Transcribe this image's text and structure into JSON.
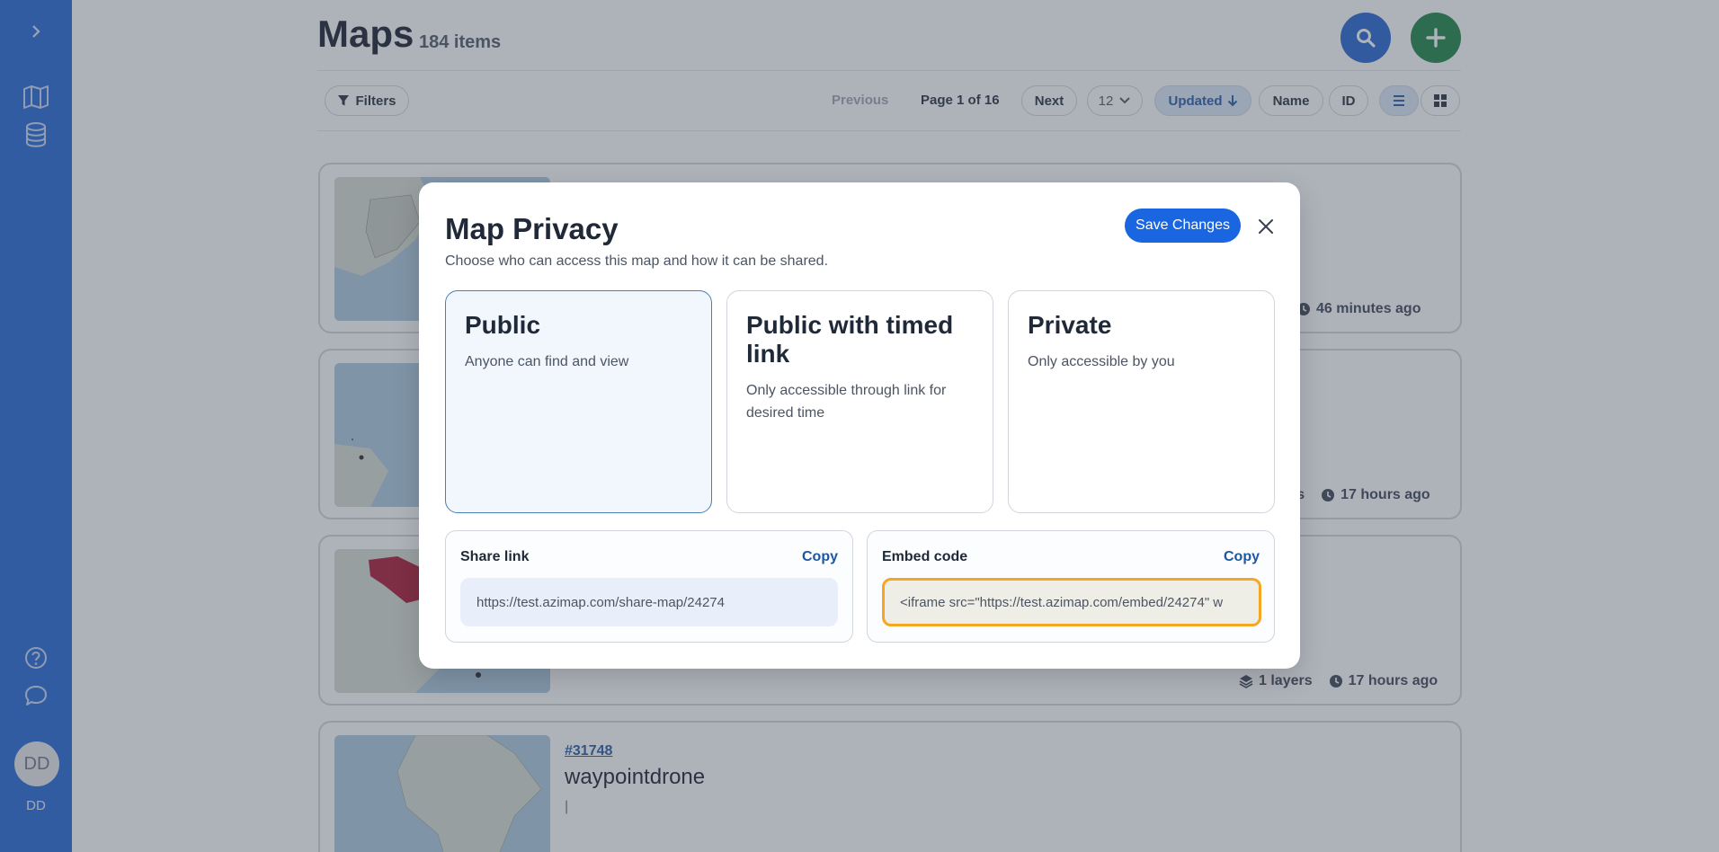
{
  "sidebar": {
    "user_initials": "DD",
    "user_label": "DD"
  },
  "header": {
    "title": "Maps",
    "count": "184 items"
  },
  "toolbar": {
    "filters_label": "Filters",
    "previous_label": "Previous",
    "page_label": "Page 1 of 16",
    "next_label": "Next",
    "per_page": "12",
    "sort_updated": "Updated",
    "sort_name": "Name",
    "sort_id": "ID"
  },
  "cards": [
    {
      "time": "46 minutes ago"
    },
    {
      "layers": "rs",
      "time": "17 hours ago"
    },
    {
      "layers": "1 layers",
      "time": "17 hours ago"
    },
    {
      "id": "#31748",
      "name": "waypointdrone",
      "desc": "|"
    }
  ],
  "modal": {
    "title": "Map Privacy",
    "subtitle": "Choose who can access this map and how it can be shared.",
    "save_label": "Save Changes",
    "options": [
      {
        "title": "Public",
        "desc": "Anyone can find and view",
        "selected": true
      },
      {
        "title": "Public with timed link",
        "desc": "Only accessible through link for desired time",
        "selected": false
      },
      {
        "title": "Private",
        "desc": "Only accessible by you",
        "selected": false
      }
    ],
    "share": {
      "label": "Share link",
      "copy_label": "Copy",
      "value": "https://test.azimap.com/share-map/24274"
    },
    "embed": {
      "label": "Embed code",
      "copy_label": "Copy",
      "value": "<iframe src=\"https://test.azimap.com/embed/24274\" w"
    }
  },
  "colors": {
    "sidebar": "#1e63d6",
    "primary": "#1a66e0",
    "add": "#16a34a",
    "embed_focus": "#f5a623"
  }
}
